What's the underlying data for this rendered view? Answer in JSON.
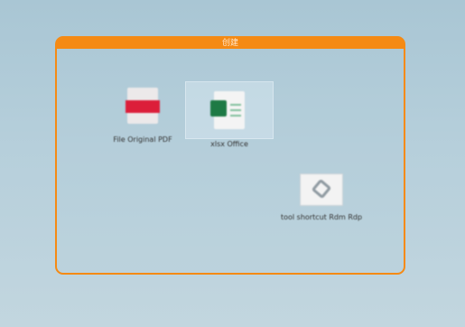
{
  "fence": {
    "title": "创建"
  },
  "icons": [
    {
      "name": "pdf",
      "label": "File Original PDF",
      "selected": false
    },
    {
      "name": "excel",
      "label": "xlsx Office",
      "selected": true
    },
    {
      "name": "shortcut",
      "label": "tool shortcut Rdm Rdp",
      "selected": false
    }
  ]
}
